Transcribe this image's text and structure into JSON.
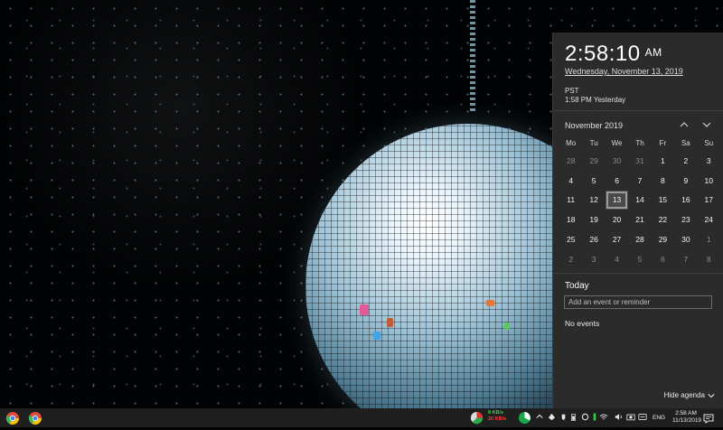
{
  "flyout": {
    "time": "2:58:10",
    "ampm": "AM",
    "date": "Wednesday, November 13, 2019",
    "tz_label": "PST",
    "tz_time": "1:58 PM Yesterday",
    "month_label": "November 2019",
    "weekdays": [
      "Mo",
      "Tu",
      "We",
      "Th",
      "Fr",
      "Sa",
      "Su"
    ],
    "days": [
      {
        "d": "28",
        "dim": true
      },
      {
        "d": "29",
        "dim": true
      },
      {
        "d": "30",
        "dim": true
      },
      {
        "d": "31",
        "dim": true
      },
      {
        "d": "1"
      },
      {
        "d": "2"
      },
      {
        "d": "3"
      },
      {
        "d": "4"
      },
      {
        "d": "5"
      },
      {
        "d": "6"
      },
      {
        "d": "7"
      },
      {
        "d": "8"
      },
      {
        "d": "9"
      },
      {
        "d": "10"
      },
      {
        "d": "11"
      },
      {
        "d": "12"
      },
      {
        "d": "13",
        "today": true
      },
      {
        "d": "14"
      },
      {
        "d": "15"
      },
      {
        "d": "16"
      },
      {
        "d": "17"
      },
      {
        "d": "18"
      },
      {
        "d": "19"
      },
      {
        "d": "20"
      },
      {
        "d": "21"
      },
      {
        "d": "22"
      },
      {
        "d": "23"
      },
      {
        "d": "24"
      },
      {
        "d": "25"
      },
      {
        "d": "26"
      },
      {
        "d": "27"
      },
      {
        "d": "28"
      },
      {
        "d": "29"
      },
      {
        "d": "30"
      },
      {
        "d": "1",
        "dim": true
      },
      {
        "d": "2",
        "dim": true
      },
      {
        "d": "3",
        "dim": true
      },
      {
        "d": "4",
        "dim": true
      },
      {
        "d": "5",
        "dim": true
      },
      {
        "d": "6",
        "dim": true
      },
      {
        "d": "7",
        "dim": true
      },
      {
        "d": "8",
        "dim": true
      }
    ],
    "agenda_title": "Today",
    "event_placeholder": "Add an event or reminder",
    "no_events": "No events",
    "hide_agenda": "Hide agenda"
  },
  "taskbar": {
    "up_speed": "8 KB/s",
    "down_speed": "20 KB/s",
    "lang": "ENG",
    "time": "2:58 AM",
    "date": "11/13/2019",
    "colors": {
      "up": "#3ad14a",
      "down": "#ff3b3b"
    },
    "icons": [
      "chrome-icon",
      "chrome-icon",
      "network-meter-icon",
      "cpu-gauge-icon",
      "chevron-up-icon",
      "dropbox-icon",
      "usb-icon",
      "battery-icon",
      "update-icon",
      "green-status-icon",
      "wifi-icon",
      "volume-icon",
      "camera-icon",
      "teamviewer-icon",
      "keyboard-icon",
      "notification-icon"
    ]
  }
}
